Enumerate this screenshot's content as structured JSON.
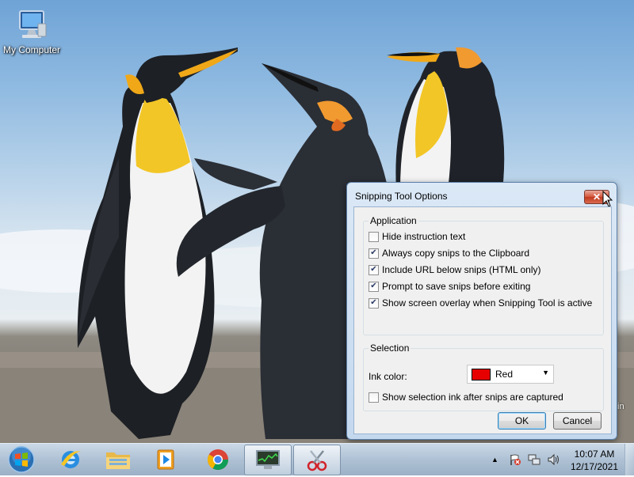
{
  "desktop": {
    "icons": [
      {
        "label": "My Computer",
        "icon": "computer-icon"
      }
    ],
    "wallpaper_edge_text": "in"
  },
  "dialog": {
    "title": "Snipping Tool Options",
    "application": {
      "title": "Application",
      "options": [
        {
          "label": "Hide instruction text",
          "checked": false
        },
        {
          "label": "Always copy snips to the Clipboard",
          "checked": true
        },
        {
          "label": "Include URL below snips (HTML only)",
          "checked": true
        },
        {
          "label": "Prompt to save snips before exiting",
          "checked": true
        },
        {
          "label": "Show screen overlay when Snipping Tool is active",
          "checked": true
        }
      ]
    },
    "selection": {
      "title": "Selection",
      "ink_label": "Ink color:",
      "ink_value": "Red",
      "ink_color": "#e60000",
      "show_ink": {
        "label": "Show selection ink after snips are captured",
        "checked": false
      }
    },
    "buttons": {
      "ok": "OK",
      "cancel": "Cancel"
    }
  },
  "taskbar": {
    "items": [
      {
        "name": "start",
        "icon": "windows-orb-icon"
      },
      {
        "name": "internet-explorer",
        "icon": "internet-explorer-icon"
      },
      {
        "name": "file-explorer",
        "icon": "folder-icon"
      },
      {
        "name": "media-player",
        "icon": "media-player-icon"
      },
      {
        "name": "chrome",
        "icon": "chrome-icon"
      },
      {
        "name": "task-manager",
        "icon": "monitor-icon",
        "active": true
      },
      {
        "name": "snipping-tool",
        "icon": "scissors-icon",
        "active": true
      }
    ],
    "clock": {
      "time": "10:07 AM",
      "date": "12/17/2021"
    }
  }
}
